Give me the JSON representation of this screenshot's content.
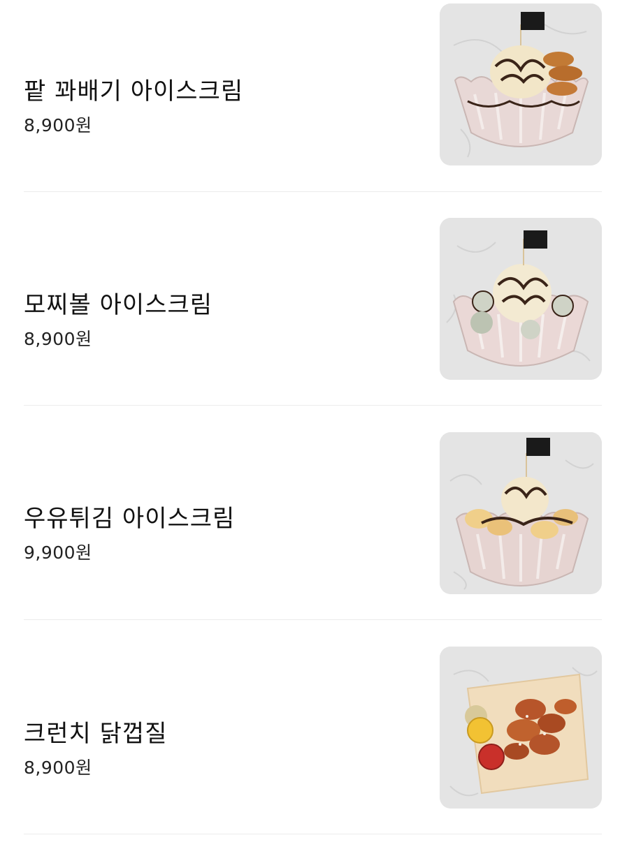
{
  "menu": {
    "items": [
      {
        "name": "팥 꽈배기 아이스크림",
        "price": "8,900원",
        "image_icon": "twisted-donut-ice-cream-photo"
      },
      {
        "name": "모찌볼 아이스크림",
        "price": "8,900원",
        "image_icon": "mochi-ball-ice-cream-photo"
      },
      {
        "name": "우유튀김 아이스크림",
        "price": "9,900원",
        "image_icon": "fried-milk-ice-cream-photo"
      },
      {
        "name": "크런치 닭껍질",
        "price": "8,900원",
        "image_icon": "crunchy-chicken-skin-photo"
      }
    ]
  },
  "colors": {
    "background": "#ffffff",
    "divider": "#ececec",
    "photo_background": "#e4e4e4",
    "text": "#111111"
  }
}
